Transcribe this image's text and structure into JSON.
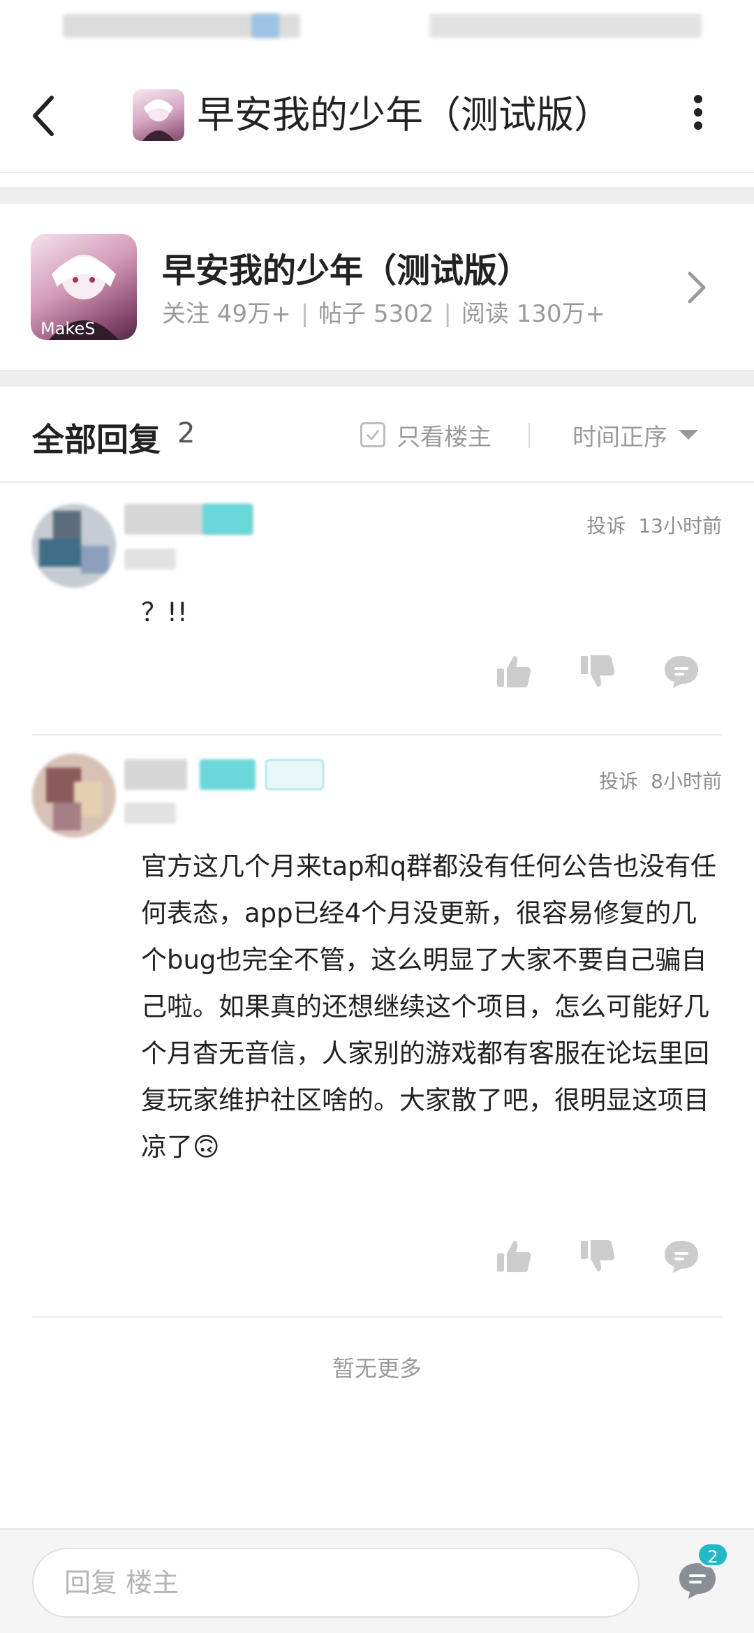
{
  "header": {
    "title": "早安我的少年（测试版）",
    "back_icon": "chevron-left-icon",
    "more_icon": "more-vertical-icon"
  },
  "forum": {
    "name": "早安我的少年（测试版）",
    "followers": "关注 49万+",
    "posts": "帖子 5302",
    "reads": "阅读 130万+",
    "separator": "|",
    "avatar_logo": "MakeS"
  },
  "replies_section": {
    "title": "全部回复",
    "count": "2",
    "only_op_label": "只看楼主",
    "sort_label": "时间正序"
  },
  "replies": [
    {
      "complain": "投诉",
      "time": "13小时前",
      "text": "？!!"
    },
    {
      "complain": "投诉",
      "time": "8小时前",
      "text": "官方这几个月来tap和q群都没有任何公告也没有任何表态，app已经4个月没更新，很容易修复的几个bug也完全不管，这么明显了大家不要自己骗自己啦。如果真的还想继续这个项目，怎么可能好几个月杳无音信，人家别的游戏都有客服在论坛里回复玩家维护社区啥的。大家散了吧，很明显这项目凉了🙃"
    }
  ],
  "footer": {
    "no_more": "暂无更多"
  },
  "bottom_bar": {
    "input_placeholder": "回复  楼主",
    "comment_badge": "2"
  },
  "colors": {
    "accent": "#21b8c8",
    "muted_text": "#9a9a9a",
    "separator": "#eeeeee"
  }
}
